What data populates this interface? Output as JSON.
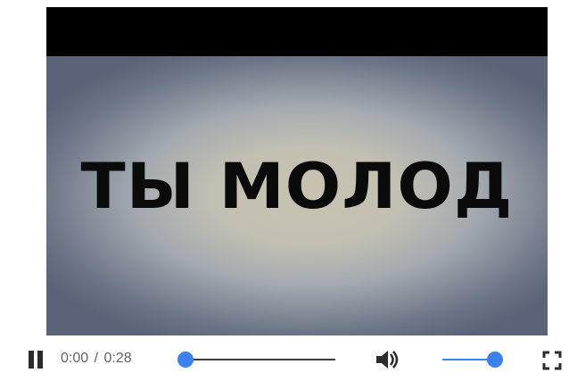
{
  "video": {
    "frame_text": "ТЫ МОЛОД"
  },
  "controls": {
    "state": "playing",
    "pause_icon": "pause-icon",
    "current_time": "0:00",
    "separator": "/",
    "duration": "0:28",
    "seek_progress": 0.0,
    "volume_icon": "volume-up-icon",
    "volume_level": 0.9,
    "fullscreen_icon": "fullscreen-icon"
  },
  "colors": {
    "accent": "#3b82f0",
    "track": "#3c3c3c",
    "icon": "#2b2b2b",
    "time_text": "#5f6368"
  }
}
